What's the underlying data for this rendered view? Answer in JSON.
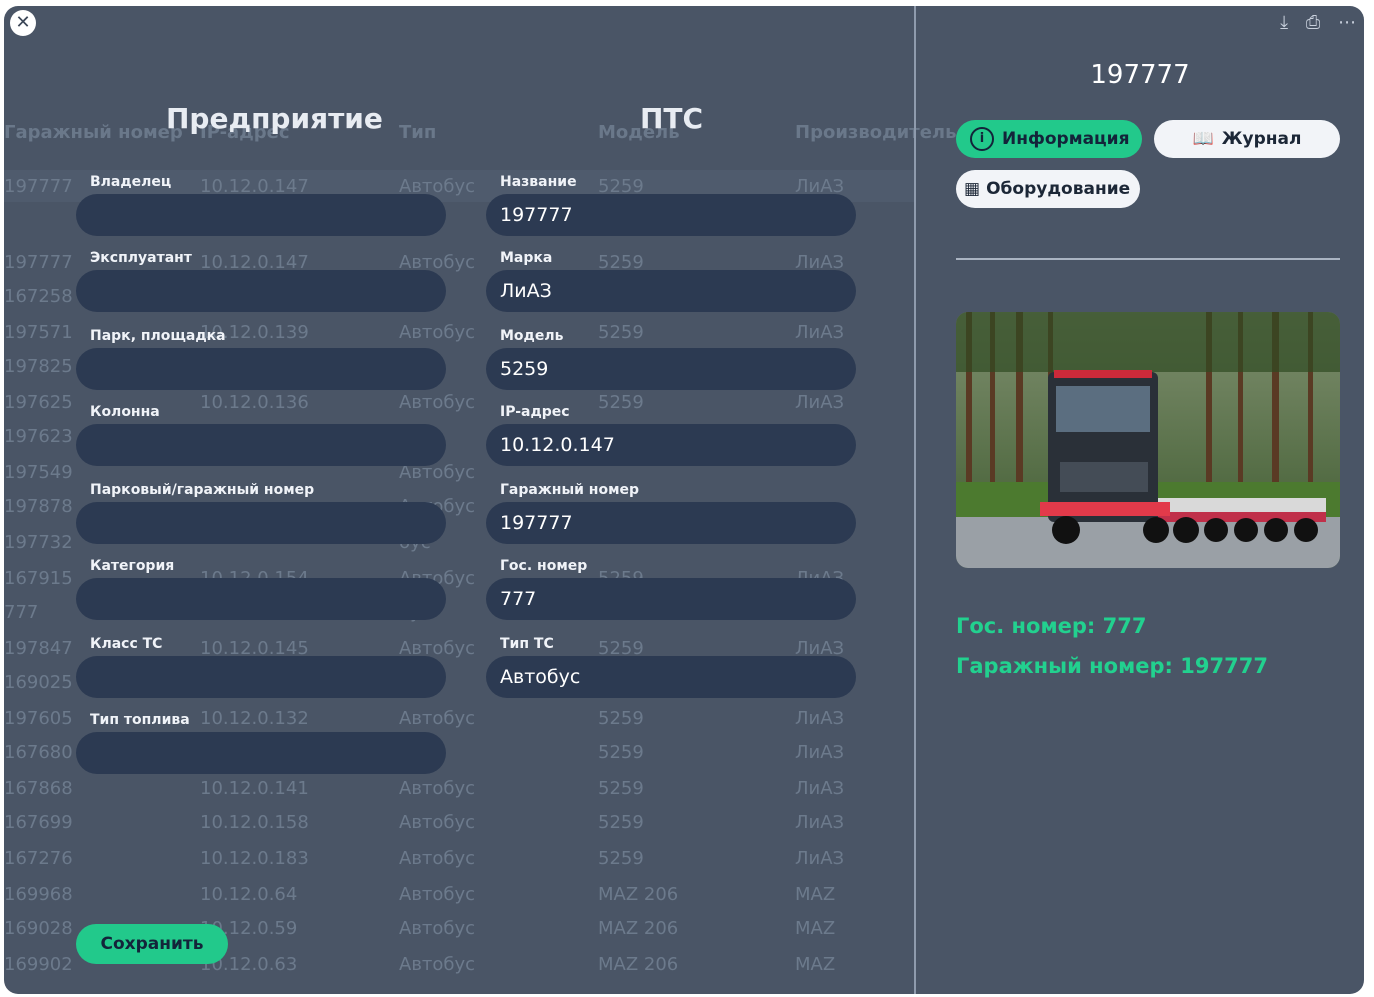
{
  "window": {
    "close_label": "✕"
  },
  "table": {
    "headers": [
      "Гаражный номер",
      "IP-адрес",
      "Тип",
      "Модель",
      "Производитель"
    ],
    "rows": [
      [
        "197777",
        "10.12.0.147",
        "Автобус",
        "5259",
        "ЛиАЗ"
      ],
      [
        "197777",
        "10.12.0.147",
        "Автобус",
        "5259",
        "ЛиАЗ"
      ],
      [
        "167258",
        "",
        "бус",
        "",
        ""
      ],
      [
        "197571",
        "10.12.0.139",
        "Автобус",
        "5259",
        "ЛиАЗ"
      ],
      [
        "197825",
        "",
        "бус",
        "",
        ""
      ],
      [
        "197625",
        "10.12.0.136",
        "Автобус",
        "5259",
        "ЛиАЗ"
      ],
      [
        "197623",
        "",
        "бус",
        "",
        ""
      ],
      [
        "197549",
        "",
        "Автобус",
        "",
        ""
      ],
      [
        "197878",
        "",
        "Автобус",
        "",
        ""
      ],
      [
        "197732",
        "",
        "бус",
        "",
        ""
      ],
      [
        "167915",
        "10.12.0.154",
        "Автобус",
        "5259",
        "ЛиАЗ"
      ],
      [
        "777",
        "",
        "бус",
        "",
        ""
      ],
      [
        "197847",
        "10.12.0.145",
        "Автобус",
        "5259",
        "ЛиАЗ"
      ],
      [
        "169025",
        "",
        "бус",
        "",
        ""
      ],
      [
        "197605",
        "10.12.0.132",
        "Автобус",
        "5259",
        "ЛиАЗ"
      ],
      [
        "167680",
        "",
        "бус",
        "5259",
        "ЛиАЗ"
      ],
      [
        "167868",
        "10.12.0.141",
        "Автобус",
        "5259",
        "ЛиАЗ"
      ],
      [
        "167699",
        "10.12.0.158",
        "Автобус",
        "5259",
        "ЛиАЗ"
      ],
      [
        "167276",
        "10.12.0.183",
        "Автобус",
        "5259",
        "ЛиАЗ"
      ],
      [
        "169968",
        "10.12.0.64",
        "Автобус",
        "MAZ 206",
        "MAZ"
      ],
      [
        "169028",
        "10.12.0.59",
        "Автобус",
        "MAZ 206",
        "MAZ"
      ],
      [
        "169902",
        "10.12.0.63",
        "Автобус",
        "MAZ 206",
        "MAZ"
      ]
    ]
  },
  "enterprise": {
    "title": "Предприятие",
    "fields": [
      {
        "label": "Владелец",
        "value": ""
      },
      {
        "label": "Эксплуатант",
        "value": ""
      },
      {
        "label": "Парк, площадка",
        "value": ""
      },
      {
        "label": "Колонна",
        "value": ""
      },
      {
        "label": "Парковый/гаражный номер",
        "value": ""
      },
      {
        "label": "Категория",
        "value": ""
      },
      {
        "label": "Класс ТС",
        "value": ""
      },
      {
        "label": "Тип топлива",
        "value": ""
      }
    ]
  },
  "pts": {
    "title": "ПТС",
    "fields": [
      {
        "label": "Название",
        "value": "197777"
      },
      {
        "label": "Марка",
        "value": "ЛиАЗ"
      },
      {
        "label": "Модель",
        "value": "5259"
      },
      {
        "label": "IP-адрес",
        "value": "10.12.0.147"
      },
      {
        "label": "Гаражный номер",
        "value": "197777"
      },
      {
        "label": "Гос. номер",
        "value": "777"
      },
      {
        "label": "Тип ТС",
        "value": "Автобус"
      }
    ]
  },
  "save_label": "Сохранить",
  "right_panel": {
    "title": "197777",
    "tabs": {
      "info": "Информация",
      "journal": "Журнал",
      "equipment": "Оборудование"
    },
    "gos_line": "Гос. номер: 777",
    "garage_line": "Гаражный номер: 197777"
  },
  "colors": {
    "accent": "#22c98b",
    "panel_bg": "#4a5566",
    "field_bg": "#2c3a52",
    "highlight_text": "#22d18f"
  }
}
